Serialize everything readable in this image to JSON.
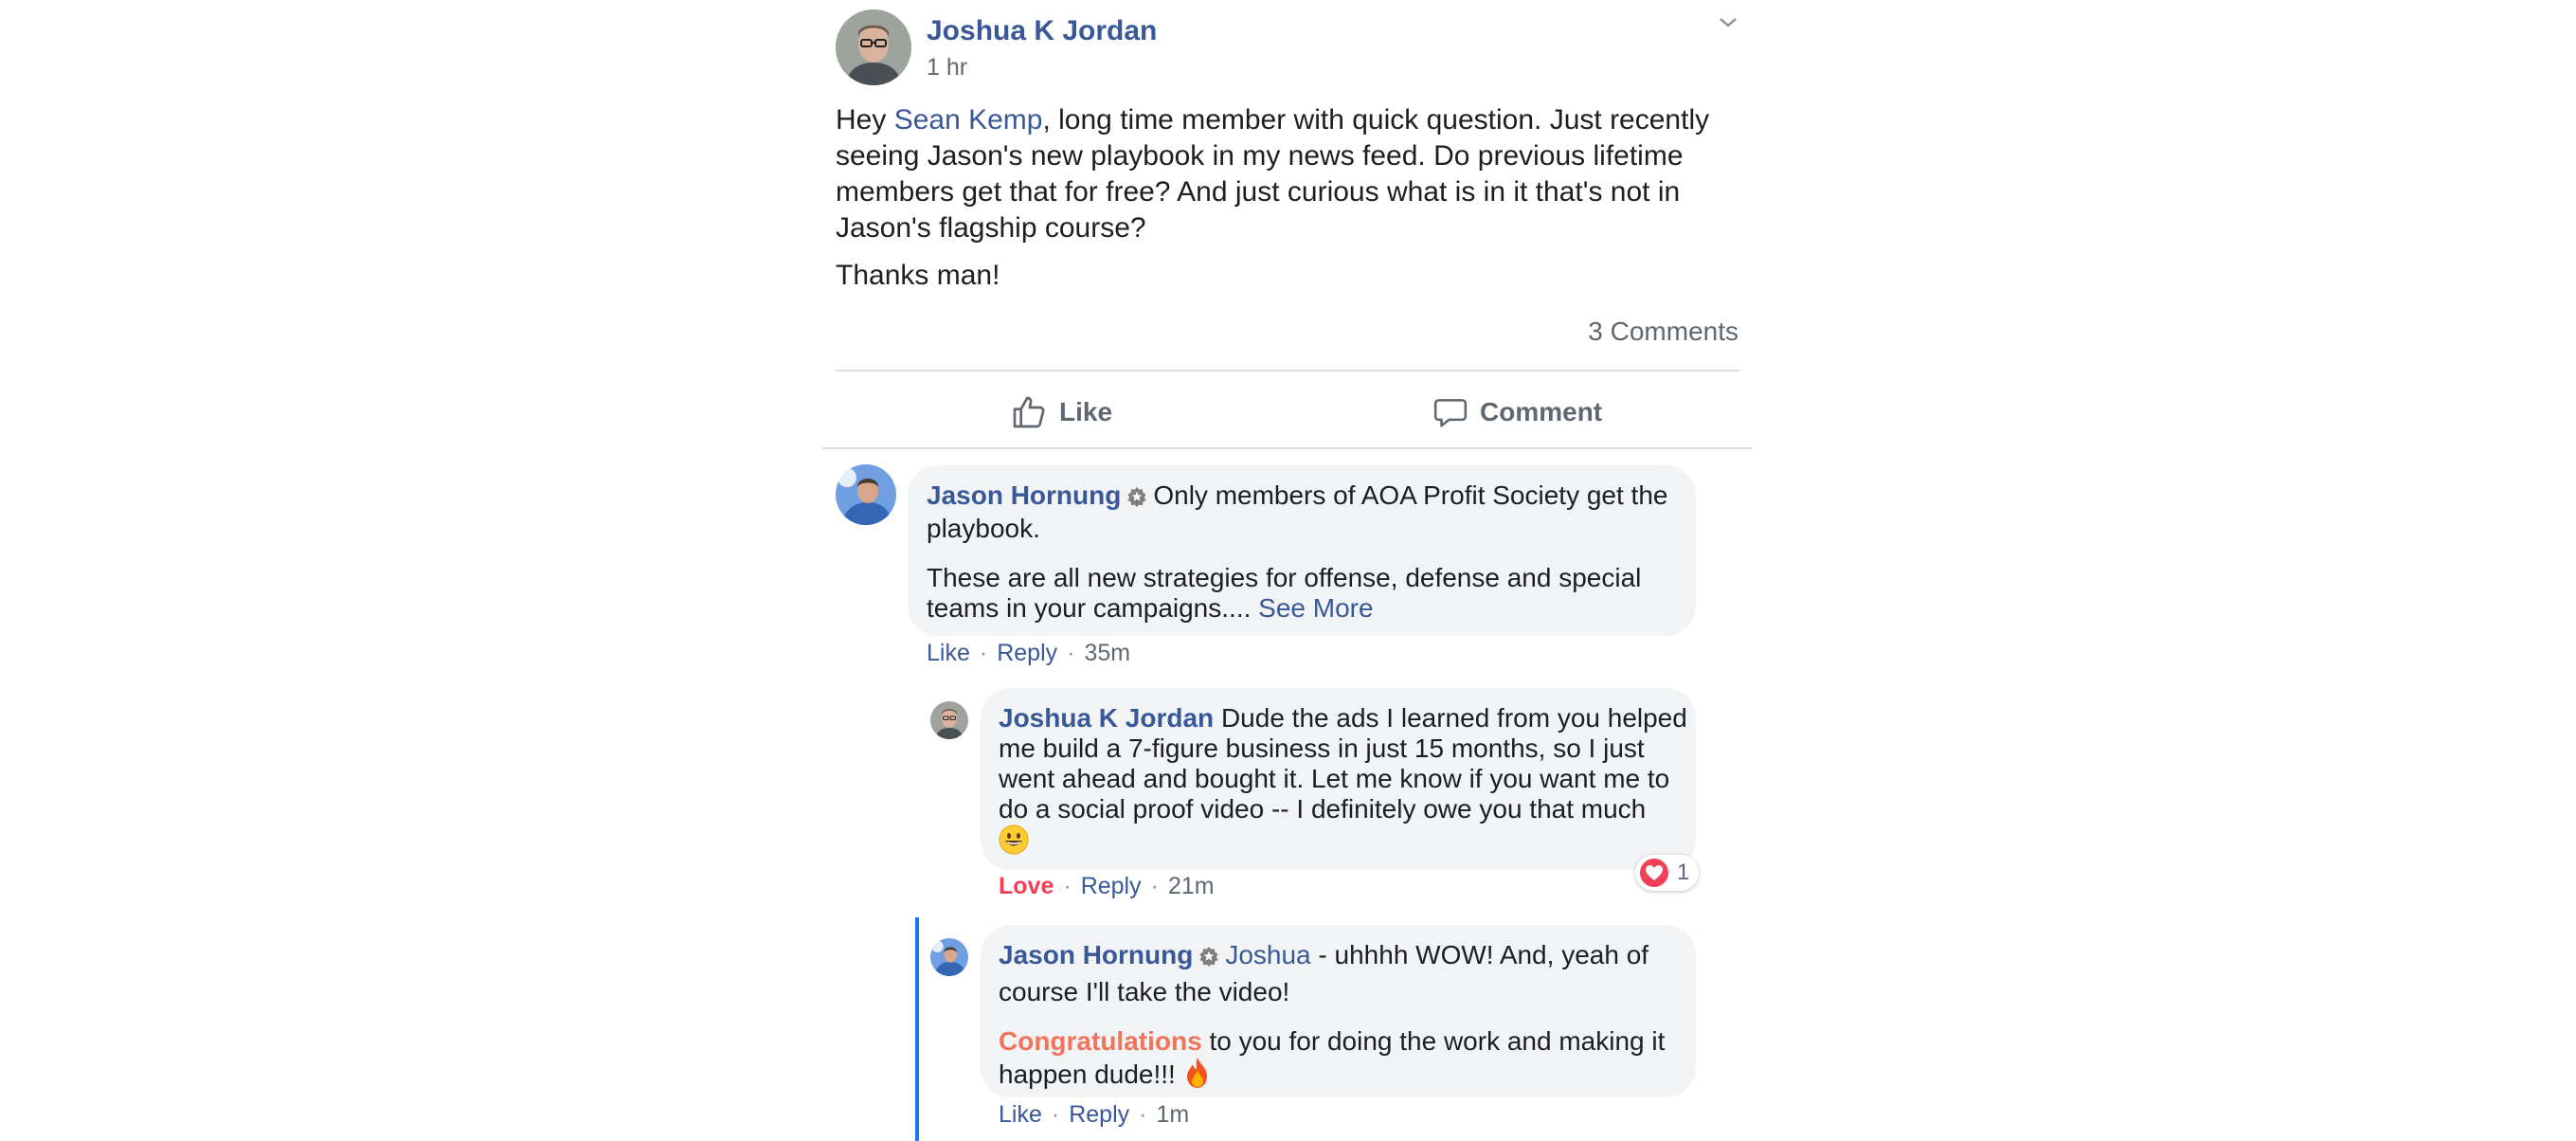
{
  "post": {
    "author": "Joshua K Jordan",
    "time": "1 hr",
    "body_intro": "Hey ",
    "body_mention": "Sean Kemp",
    "body_rest_line1": ", long time member with quick question. Just recently",
    "body_line2": "seeing Jason's new playbook in my news feed. Do previous lifetime",
    "body_line3": "members get that for free? And just curious what is in it that's not in",
    "body_line4": "Jason's flagship course?",
    "body_thanks": "Thanks man!",
    "comments_count": "3 Comments",
    "like_label": "Like",
    "comment_label": "Comment"
  },
  "comments": [
    {
      "author": "Jason Hornung",
      "text_line1": "Only members of AOA Profit Society get the",
      "text_line2": "playbook.",
      "text_line3": "These are all new strategies for offense, defense and special",
      "text_line4": "teams in your campaigns.... ",
      "see_more": "See More",
      "action_like": "Like",
      "action_reply": "Reply",
      "time": "35m"
    },
    {
      "author": "Joshua K Jordan",
      "text_line1": "Dude the ads I learned from you helped",
      "text_line2": "me build a 7-figure business in just 15 months, so I just",
      "text_line3": "went ahead and bought it. Let me know if you want me to",
      "text_line4": "do a social proof video -- I definitely owe you that much",
      "action_love": "Love",
      "action_reply": "Reply",
      "time": "21m",
      "reaction_count": "1"
    },
    {
      "author": "Jason Hornung",
      "mention": "Joshua",
      "text_line1_rest": " - uhhhh WOW! And, yeah of",
      "text_line2": "course I'll take the video!",
      "highlight": "Congratulations",
      "text_line3_rest": " to you for doing the work and making it",
      "text_line4": "happen dude!!!",
      "action_like": "Like",
      "action_reply": "Reply",
      "time": "1m"
    }
  ],
  "colors": {
    "link": "#385898",
    "love": "#f33e58",
    "congrats": "#f0735a",
    "thread_line": "#1877f2",
    "bubble": "#f2f3f5"
  }
}
